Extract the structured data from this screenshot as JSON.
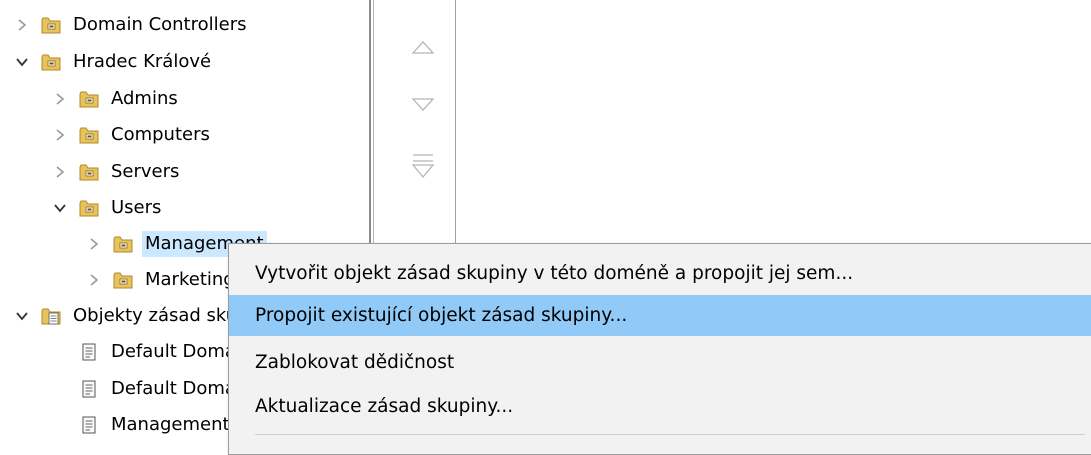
{
  "tree": [
    {
      "label": "Domain Controllers",
      "icon": "ou-folder-icon",
      "expander": "collapsed"
    },
    {
      "label": "Hradec Králové",
      "icon": "ou-folder-icon",
      "expander": "expanded"
    },
    {
      "label": "Admins",
      "icon": "ou-folder-icon",
      "expander": "collapsed"
    },
    {
      "label": "Computers",
      "icon": "ou-folder-icon",
      "expander": "collapsed"
    },
    {
      "label": "Servers",
      "icon": "ou-folder-icon",
      "expander": "collapsed"
    },
    {
      "label": "Users",
      "icon": "ou-folder-icon",
      "expander": "expanded"
    },
    {
      "label": "Management",
      "icon": "ou-folder-icon",
      "expander": "collapsed",
      "selected": true
    },
    {
      "label": "Marketing",
      "icon": "ou-folder-icon",
      "expander": "collapsed"
    },
    {
      "label": "Objekty zásad skupi",
      "icon": "gpo-container-icon",
      "expander": "expanded"
    },
    {
      "label": "Default Domain",
      "icon": "gpo-icon",
      "expander": "none"
    },
    {
      "label": "Default Domain",
      "icon": "gpo-icon",
      "expander": "none"
    },
    {
      "label": "Management GF",
      "icon": "gpo-icon",
      "expander": "none"
    }
  ],
  "order_buttons": [
    "move-up-icon",
    "move-down-icon",
    "move-to-bottom-icon"
  ],
  "context_menu": {
    "items": [
      {
        "label": "Vytvořit objekt zásad skupiny v této doméně a propojit jej sem..."
      },
      {
        "label": "Propojit existující objekt zásad skupiny...",
        "highlighted": true
      },
      {
        "label": "Zablokovat dědičnost"
      },
      {
        "label": "Aktualizace zásad skupiny..."
      }
    ]
  },
  "colors": {
    "selection": "#cce8ff",
    "menu_highlight": "#91c9f7",
    "menu_background": "#f2f2f2",
    "folder": "#e8c25a"
  }
}
